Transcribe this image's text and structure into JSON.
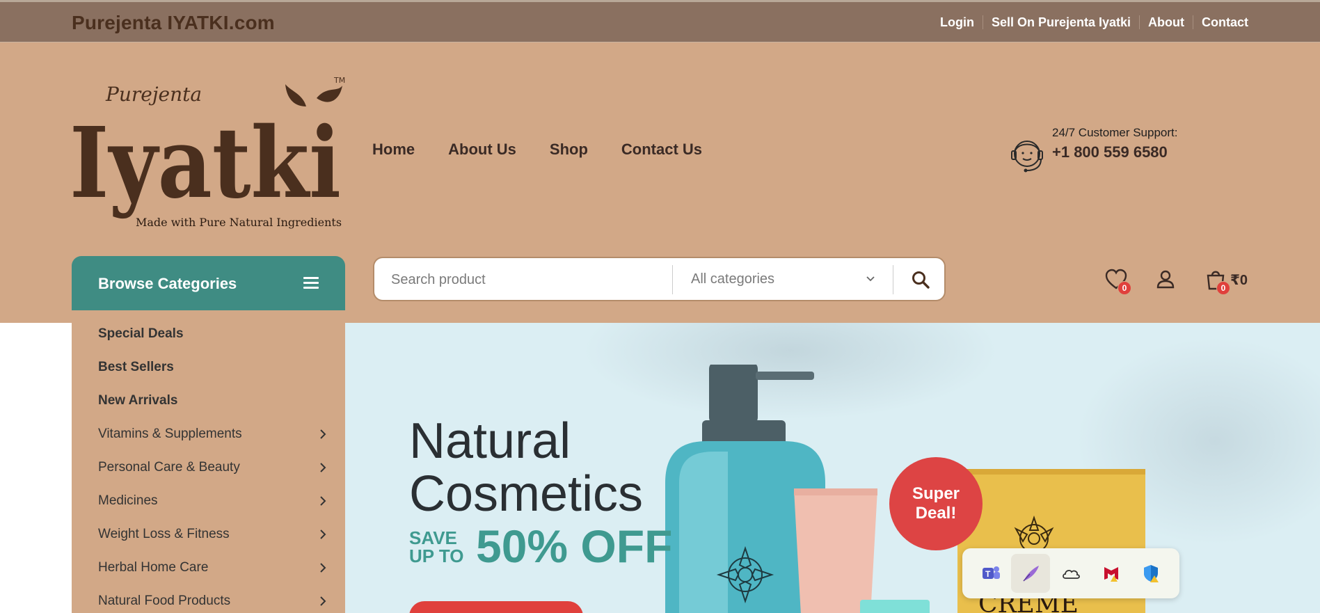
{
  "topbar": {
    "site_name": "Purejenta IYATKI.com",
    "links": [
      "Login",
      "Sell On Purejenta Iyatki",
      "About",
      "Contact"
    ]
  },
  "logo": {
    "script_text": "Purejenta",
    "brand": "Iyatki",
    "tm": "TM",
    "tagline": "Made with Pure Natural Ingredients"
  },
  "nav": {
    "items": [
      "Home",
      "About Us",
      "Shop",
      "Contact Us"
    ]
  },
  "support": {
    "label": "24/7 Customer Support:",
    "phone": "+1 800 559 6580",
    "icon": "headset-support-icon"
  },
  "browse": {
    "label": "Browse Categories",
    "icon": "menu-icon"
  },
  "categories": [
    {
      "label": "Special Deals",
      "bold": true,
      "has_submenu": false
    },
    {
      "label": "Best Sellers",
      "bold": true,
      "has_submenu": false
    },
    {
      "label": "New Arrivals",
      "bold": true,
      "has_submenu": false
    },
    {
      "label": "Vitamins & Supplements",
      "bold": false,
      "has_submenu": true
    },
    {
      "label": "Personal Care & Beauty",
      "bold": false,
      "has_submenu": true
    },
    {
      "label": "Medicines",
      "bold": false,
      "has_submenu": true
    },
    {
      "label": "Weight Loss & Fitness",
      "bold": false,
      "has_submenu": true
    },
    {
      "label": "Herbal Home Care",
      "bold": false,
      "has_submenu": true
    },
    {
      "label": "Natural Food Products",
      "bold": false,
      "has_submenu": true
    }
  ],
  "search": {
    "placeholder": "Search product",
    "category_selected": "All categories"
  },
  "header_icons": {
    "wishlist_count": "0",
    "cart_count": "0",
    "cart_total": "₹0"
  },
  "hero": {
    "title_line1": "Natural",
    "title_line2": "Cosmetics",
    "save_line1": "SAVE",
    "save_line2": "UP TO",
    "discount": "50% OFF",
    "badge_line1": "Super",
    "badge_line2": "Deal!",
    "box_text": "CREME"
  },
  "tray": {
    "icons": [
      "teams-icon",
      "feather-pen-icon",
      "onedrive-cloud-icon",
      "mcafee-icon",
      "defender-shield-icon"
    ]
  },
  "colors": {
    "topbar": "#8a7060",
    "header": "#d2a887",
    "teal": "#3f8c83",
    "hero_bg": "#dbeef3",
    "accent_red": "#e0403c",
    "brand_brown": "#4a2f1e"
  }
}
